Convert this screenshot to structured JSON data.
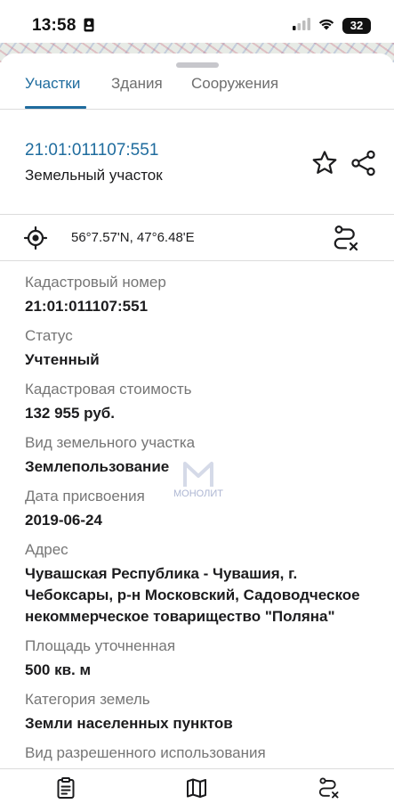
{
  "status_bar": {
    "time": "13:58",
    "battery": "32",
    "icons": [
      "id-card-icon",
      "cellular-signal-icon",
      "wifi-icon",
      "battery-icon"
    ]
  },
  "tabs": [
    {
      "label": "Участки",
      "active": true
    },
    {
      "label": "Здания",
      "active": false
    },
    {
      "label": "Сооружения",
      "active": false
    }
  ],
  "object": {
    "cadastral_link": "21:01:011107:551",
    "type": "Земельный участок"
  },
  "coordinates": {
    "text": "56°7.57'N, 47°6.48'E"
  },
  "fields": [
    {
      "label": "Кадастровый номер",
      "value": "21:01:011107:551"
    },
    {
      "label": "Статус",
      "value": "Учтенный"
    },
    {
      "label": "Кадастровая стоимость",
      "value": "132 955 руб."
    },
    {
      "label": "Вид земельного участка",
      "value": "Землепользование"
    },
    {
      "label": "Дата присвоения",
      "value": "2019-06-24"
    },
    {
      "label": "Адрес",
      "value": "Чувашская Республика - Чувашия, г. Чебоксары, р-н Московский, Садоводческое некоммерческое товарищество \"Поляна\""
    },
    {
      "label": "Площадь уточненная",
      "value": "500 кв. м"
    },
    {
      "label": "Категория земель",
      "value": "Земли населенных пунктов"
    },
    {
      "label": "Вид разрешенного использования",
      "value": ""
    }
  ],
  "watermark": "МОНОЛИТ",
  "colors": {
    "accent": "#1f6c9e",
    "label_gray": "#767676",
    "divider": "#dcdcdc"
  }
}
